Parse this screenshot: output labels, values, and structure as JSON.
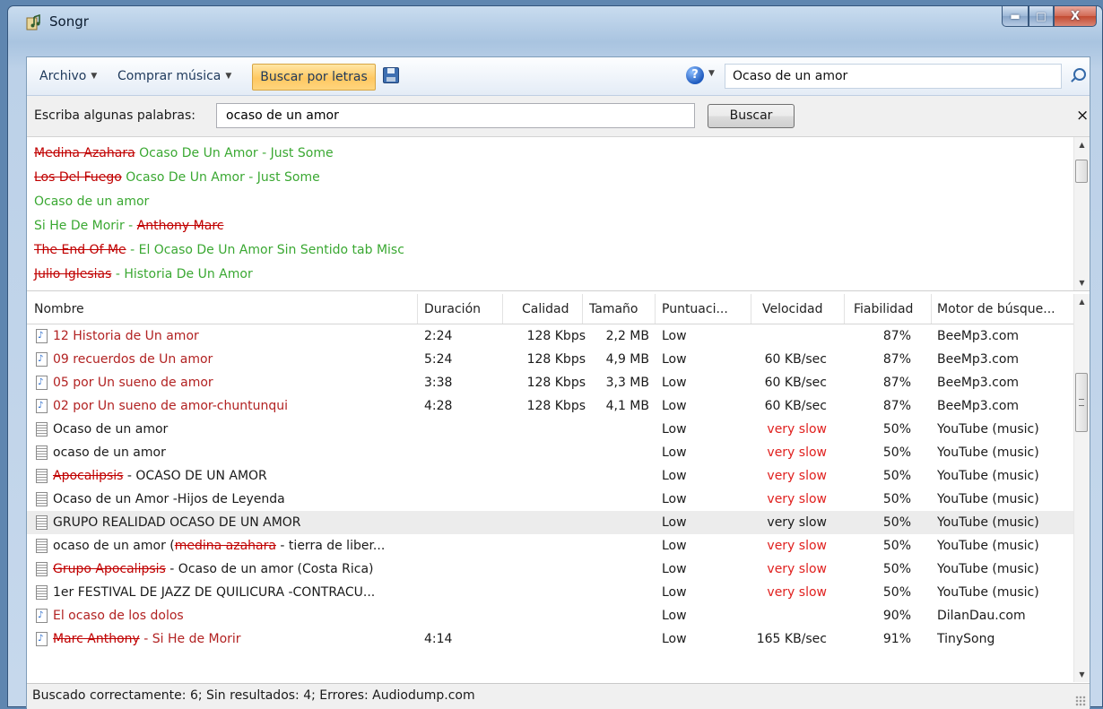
{
  "window": {
    "title": "Songr"
  },
  "toolbar": {
    "file_menu": "Archivo",
    "buy_menu": "Comprar música",
    "lyrics_search": "Buscar por letras",
    "search_value": "Ocaso de un amor"
  },
  "lyrics_bar": {
    "label": "Escriba algunas palabras:",
    "value": "ocaso de un amor",
    "button": "Buscar",
    "close": "×"
  },
  "suggestions": [
    {
      "artist": "Medina Azahara",
      "rest": " Ocaso De Un Amor  - Just Some"
    },
    {
      "artist": "Los Del Fuego",
      "rest": " Ocaso De Un Amor  - Just Some"
    },
    {
      "artist": "",
      "rest": "Ocaso de un amor"
    },
    {
      "artist": "",
      "rest": "Si He De Morir  - ",
      "tail_strike": "Anthony Marc"
    },
    {
      "artist": "The End Of Me",
      "rest": " - El Ocaso De Un Amor Sin Sentido tab Misc"
    },
    {
      "artist": "Julio Iglesias",
      "rest": " - Historia De Un Amor"
    }
  ],
  "columns": {
    "name": "Nombre",
    "duration": "Duración",
    "quality": "Calidad",
    "size": "Tamaño",
    "score": "Puntuaci...",
    "speed": "Velocidad",
    "reliability": "Fiabilidad",
    "engine": "Motor de búsque..."
  },
  "rows": [
    {
      "icon": "audio",
      "red": true,
      "name": "12 Historia de Un amor",
      "duration": "2:24",
      "quality": "128 Kbps",
      "size": "2,2 MB",
      "score": "Low",
      "speed": "",
      "reliability": "87%",
      "engine": "BeeMp3.com"
    },
    {
      "icon": "audio",
      "red": true,
      "name": "09 recuerdos de Un amor",
      "duration": "5:24",
      "quality": "128 Kbps",
      "size": "4,9 MB",
      "score": "Low",
      "speed": "60 KB/sec",
      "reliability": "87%",
      "engine": "BeeMp3.com"
    },
    {
      "icon": "audio",
      "red": true,
      "name": "05 por Un sueno de amor",
      "duration": "3:38",
      "quality": "128 Kbps",
      "size": "3,3 MB",
      "score": "Low",
      "speed": "60 KB/sec",
      "reliability": "87%",
      "engine": "BeeMp3.com"
    },
    {
      "icon": "audio",
      "red": true,
      "name": "02 por Un sueno de amor-chuntunqui",
      "duration": "4:28",
      "quality": "128 Kbps",
      "size": "4,1 MB",
      "score": "Low",
      "speed": "60 KB/sec",
      "reliability": "87%",
      "engine": "BeeMp3.com"
    },
    {
      "icon": "video",
      "name": "Ocaso de un amor",
      "score": "Low",
      "speed": "very slow",
      "slow": true,
      "reliability": "50%",
      "engine": "YouTube (music)"
    },
    {
      "icon": "video",
      "name": "ocaso de un amor",
      "score": "Low",
      "speed": "very slow",
      "slow": true,
      "reliability": "50%",
      "engine": "YouTube (music)"
    },
    {
      "icon": "video",
      "strike": "Apocalipsis",
      "name": " - OCASO DE UN AMOR",
      "score": "Low",
      "speed": "very slow",
      "slow": true,
      "reliability": "50%",
      "engine": "YouTube (music)"
    },
    {
      "icon": "video",
      "name": "Ocaso de un Amor -Hijos de Leyenda",
      "score": "Low",
      "speed": "very slow",
      "slow": true,
      "reliability": "50%",
      "engine": "YouTube (music)"
    },
    {
      "icon": "video",
      "selected": true,
      "name": "GRUPO REALIDAD OCASO DE UN AMOR",
      "score": "Low",
      "speed": "very slow",
      "reliability": "50%",
      "engine": "YouTube (music)"
    },
    {
      "icon": "video",
      "name": "ocaso de un amor (",
      "strike": "medina azahara",
      "after": " - tierra de liber...",
      "score": "Low",
      "speed": "very slow",
      "slow": true,
      "reliability": "50%",
      "engine": "YouTube (music)"
    },
    {
      "icon": "video",
      "strike": "Grupo Apocalipsis",
      "name": " - Ocaso de un amor (Costa Rica)",
      "score": "Low",
      "speed": "very slow",
      "slow": true,
      "reliability": "50%",
      "engine": "YouTube (music)"
    },
    {
      "icon": "video",
      "name": "1er FESTIVAL DE JAZZ DE QUILICURA -CONTRACU...",
      "score": "Low",
      "speed": "very slow",
      "slow": true,
      "reliability": "50%",
      "engine": "YouTube (music)"
    },
    {
      "icon": "audio",
      "red": true,
      "name": "El ocaso de los dolos",
      "score": "Low",
      "speed": "",
      "reliability": "90%",
      "engine": "DilanDau.com"
    },
    {
      "icon": "audio",
      "red": true,
      "strike": "Marc Anthony",
      "name": " - Si He de Morir",
      "duration": "4:14",
      "score": "Low",
      "speed": "165 KB/sec",
      "reliability": "91%",
      "engine": "TinySong"
    }
  ],
  "status": {
    "text": "Buscado correctamente: 6; Sin resultados: 4; Errores: Audiodump.com"
  }
}
